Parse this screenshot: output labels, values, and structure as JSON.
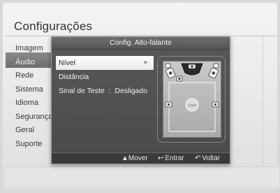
{
  "screen": {
    "title": "Configurações"
  },
  "sidebar": {
    "items": [
      {
        "label": "Imagem",
        "active": false
      },
      {
        "label": "Áudio",
        "active": true
      },
      {
        "label": "Rede",
        "active": false
      },
      {
        "label": "Sistema",
        "active": false
      },
      {
        "label": "Idioma",
        "active": false
      },
      {
        "label": "Segurança",
        "active": false
      },
      {
        "label": "Geral",
        "active": false
      },
      {
        "label": "Suporte",
        "active": false
      }
    ]
  },
  "dialog": {
    "title": "Config. Alto-falante",
    "menu": [
      {
        "label": "Nível",
        "selected": true,
        "has_arrow": true
      },
      {
        "label": "Distância",
        "selected": false,
        "has_arrow": false
      },
      {
        "label": "Sinal de Teste  :  Desligado",
        "selected": false,
        "has_arrow": false
      }
    ],
    "speaker_map": {
      "user_label": "User"
    },
    "footer": {
      "move": {
        "icon": "up-down-icon",
        "label": "Mover"
      },
      "enter": {
        "icon": "enter-icon",
        "label": "Entrar"
      },
      "back": {
        "icon": "return-icon",
        "label": "Voltar"
      }
    }
  },
  "colors": {
    "dialog_bg": "#505050",
    "selected_bg": "#ffffff",
    "room_bg": "#bdbdbd"
  }
}
